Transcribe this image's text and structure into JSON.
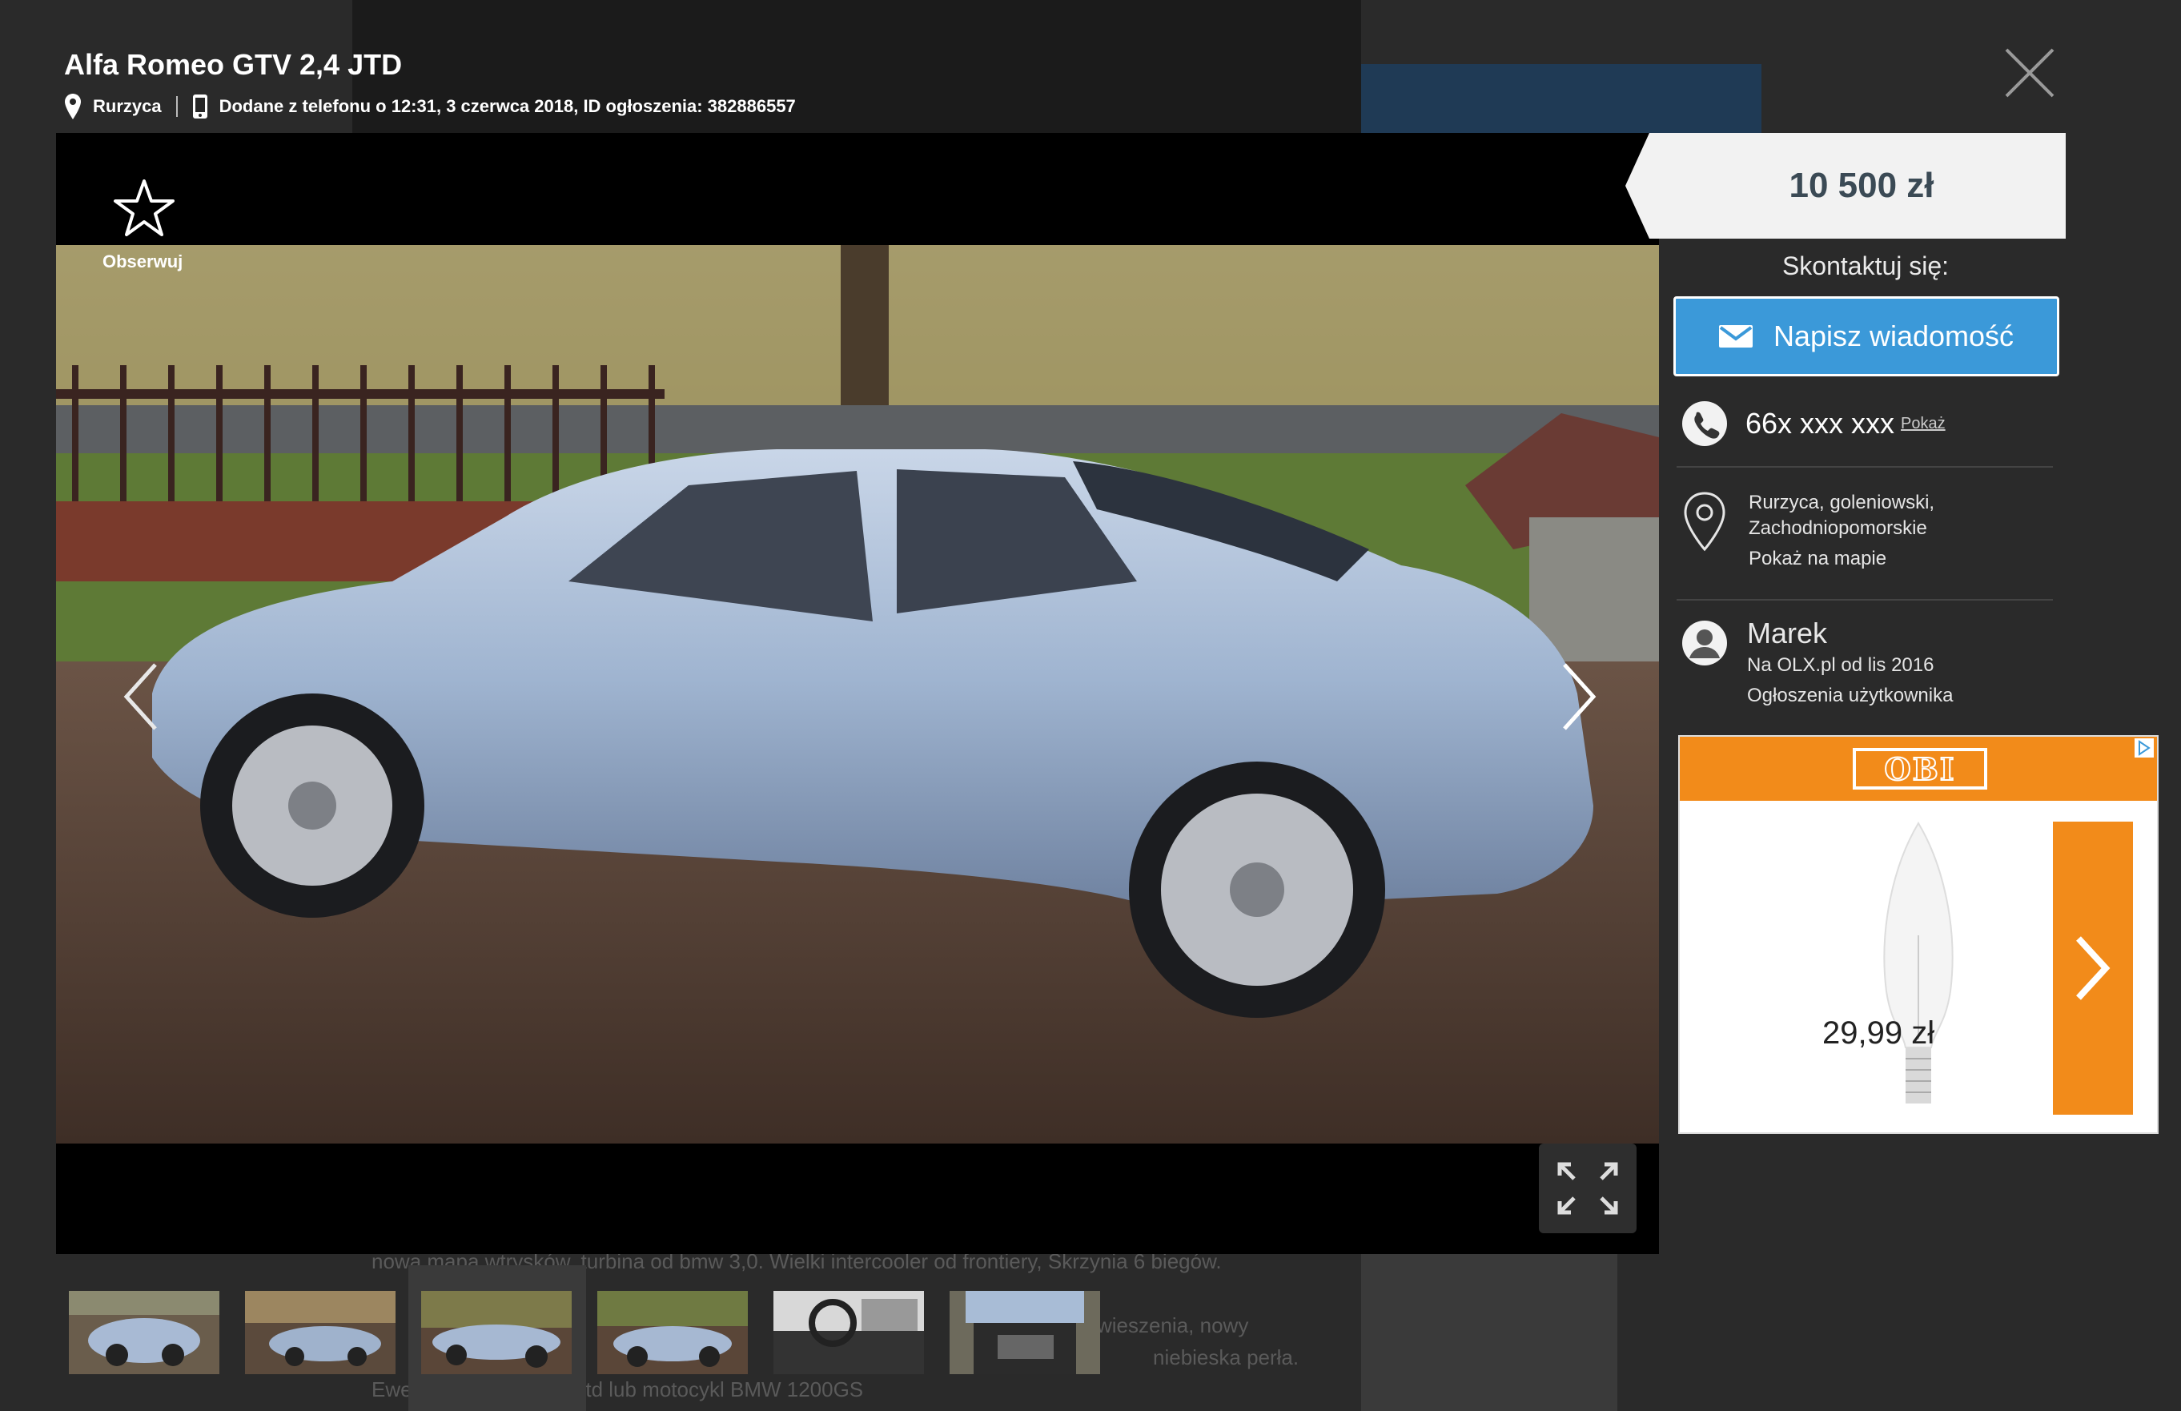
{
  "listing": {
    "title": "Alfa Romeo GTV 2,4 JTD",
    "location": "Rurzyca",
    "added": "Dodane z telefonu o 12:31, 3 czerwca 2018, ID ogłoszenia: 382886557",
    "observe_label": "Obserwuj",
    "price": "10 500 zł"
  },
  "contact": {
    "label": "Skontaktuj się:",
    "message_button": "Napisz wiadomość",
    "phone": "66x xxx xxx",
    "phone_show": "Pokaż",
    "address_line1": "Rurzyca, goleniowski,",
    "address_line2": "Zachodniopomorskie",
    "map_link": "Pokaż na mapie"
  },
  "seller": {
    "name": "Marek",
    "since": "Na OLX.pl od lis 2016",
    "listings_link": "Ogłoszenia użytkownika"
  },
  "ad": {
    "brand": "OBI",
    "price": "29,99 zł"
  },
  "background": {
    "line1": "nowa mapa wtrysków, turbina od bmw 3,0. Wielki intercooler od frontiery, Skrzynia 6 biegów.",
    "line2": "wieszenia, nowy",
    "line3": "niebieska perła.",
    "line4": "Ewe                   tylko na Brere 2,4jtd lub motocykl BMW 1200GS"
  },
  "colors": {
    "accent_blue": "#3b99d9",
    "ad_orange": "#f28b1a",
    "price_text": "#3b4a55"
  },
  "icons": {
    "close": "close-icon",
    "star": "star-icon",
    "prev": "chevron-left-icon",
    "next": "chevron-right-icon",
    "expand": "expand-icon",
    "mail": "mail-icon",
    "phone": "phone-icon",
    "pin": "map-pin-icon",
    "avatar": "user-avatar-icon"
  }
}
